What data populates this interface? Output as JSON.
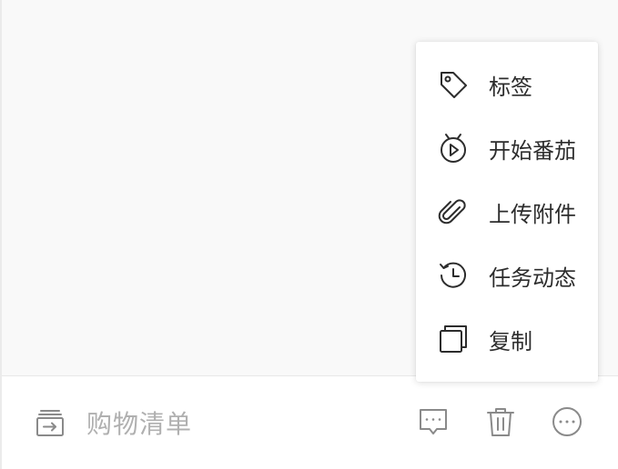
{
  "menu": {
    "items": [
      {
        "label": "标签",
        "icon": "tag-icon"
      },
      {
        "label": "开始番茄",
        "icon": "pomodoro-timer-icon"
      },
      {
        "label": "上传附件",
        "icon": "paperclip-icon"
      },
      {
        "label": "任务动态",
        "icon": "history-icon"
      },
      {
        "label": "复制",
        "icon": "copy-icon"
      }
    ]
  },
  "bottom_bar": {
    "list_name": "购物清单",
    "list_icon": "move-to-list-icon",
    "actions": [
      {
        "icon": "comment-icon"
      },
      {
        "icon": "trash-icon"
      },
      {
        "icon": "more-icon"
      }
    ]
  },
  "colors": {
    "icon_stroke": "#2c2c2c",
    "bar_icon_stroke": "#8a8a8a",
    "placeholder_text": "#b0b0b0",
    "content_background": "#f9f9f9"
  }
}
